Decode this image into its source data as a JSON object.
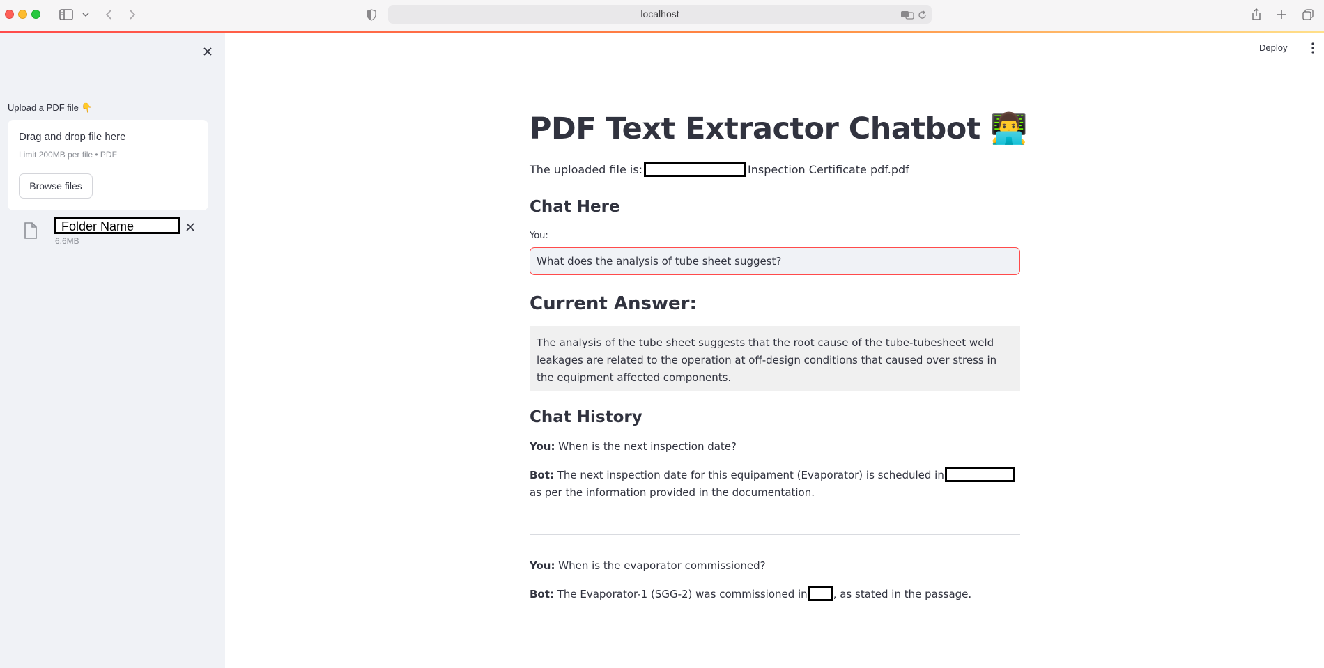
{
  "browser": {
    "url": "localhost"
  },
  "sidebar": {
    "upload_label": "Upload a PDF file 👇",
    "dropzone_title": "Drag and drop file here",
    "dropzone_limit": "Limit 200MB per file • PDF",
    "browse_label": "Browse files",
    "file": {
      "name": "Folder Name",
      "size": "6.6MB"
    }
  },
  "appbar": {
    "deploy_label": "Deploy"
  },
  "main": {
    "title": "PDF Text Extractor Chatbot 👨‍💻",
    "uploaded_prefix": "The uploaded file is:",
    "uploaded_suffix": "Inspection Certificate pdf.pdf",
    "chat_heading": "Chat Here",
    "you_label": "You:",
    "question_value": "What does the analysis of tube sheet suggest?",
    "answer_heading": "Current Answer:",
    "answer_text": "The analysis of the tube sheet suggests that the root cause of the tube-tubesheet weld leakages are related to the operation at off-design conditions that caused over stress in the equipment affected components.",
    "history_heading": "Chat History",
    "history": [
      {
        "you_label": "You:",
        "question": "When is the next inspection date?",
        "bot_label": "Bot:",
        "answer_before": "The next inspection date for this equipament (Evaporator) is scheduled in",
        "answer_after": " as per the information provided in the documentation."
      },
      {
        "you_label": "You:",
        "question": "When is the evaporator commissioned?",
        "bot_label": "Bot:",
        "answer_before": "The Evaporator-1 (SGG-2) was commissioned in",
        "answer_after": ", as stated in the passage."
      }
    ]
  },
  "colors": {
    "accent": "#ff4b4b",
    "sidebar_bg": "#f0f2f6",
    "text": "#31333f"
  }
}
